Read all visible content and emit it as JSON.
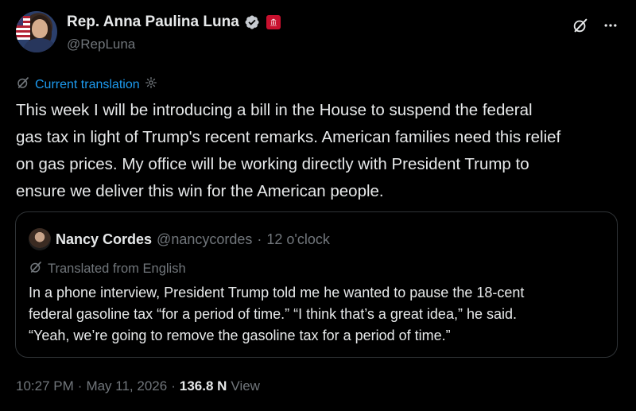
{
  "author": {
    "name": "Rep. Anna Paulina Luna",
    "handle": "@RepLuna"
  },
  "translation": {
    "label": "Current translation"
  },
  "post": {
    "lines": [
      "This week I will be introducing a bill in the House to suspend the federal",
      "gas tax in light of Trump's recent remarks. American families need this relief",
      "on gas prices. My office will be working directly with President Trump to",
      "ensure we deliver this win for the American people."
    ]
  },
  "quote": {
    "name": "Nancy Cordes",
    "handle": "@nancycordes",
    "separator": "·",
    "time": "12 o'clock",
    "translated_label": "Translated from English",
    "lines": [
      "In a phone interview, President Trump told me he wanted to pause the 18-cent",
      "federal gasoline tax “for a period of time.” “I think that’s a great idea,” he said.",
      "“Yeah, we’re going to remove the gasoline tax for a period of time.”"
    ]
  },
  "footer": {
    "time": "10:27 PM",
    "sep1": "·",
    "date": "May 11, 2026",
    "sep2": "·",
    "views_count": "136.8 N",
    "views_label": "View"
  },
  "colors": {
    "background": "#000000",
    "text": "#e7e9ea",
    "muted": "#71767b",
    "accent": "#1d9bf0",
    "border": "#2f3336",
    "affiliation": "#c8102e"
  },
  "icons": [
    "verified-badge-icon",
    "house-affiliation-icon",
    "grok-icon",
    "more-icon",
    "translate-icon",
    "settings-gear-icon"
  ]
}
